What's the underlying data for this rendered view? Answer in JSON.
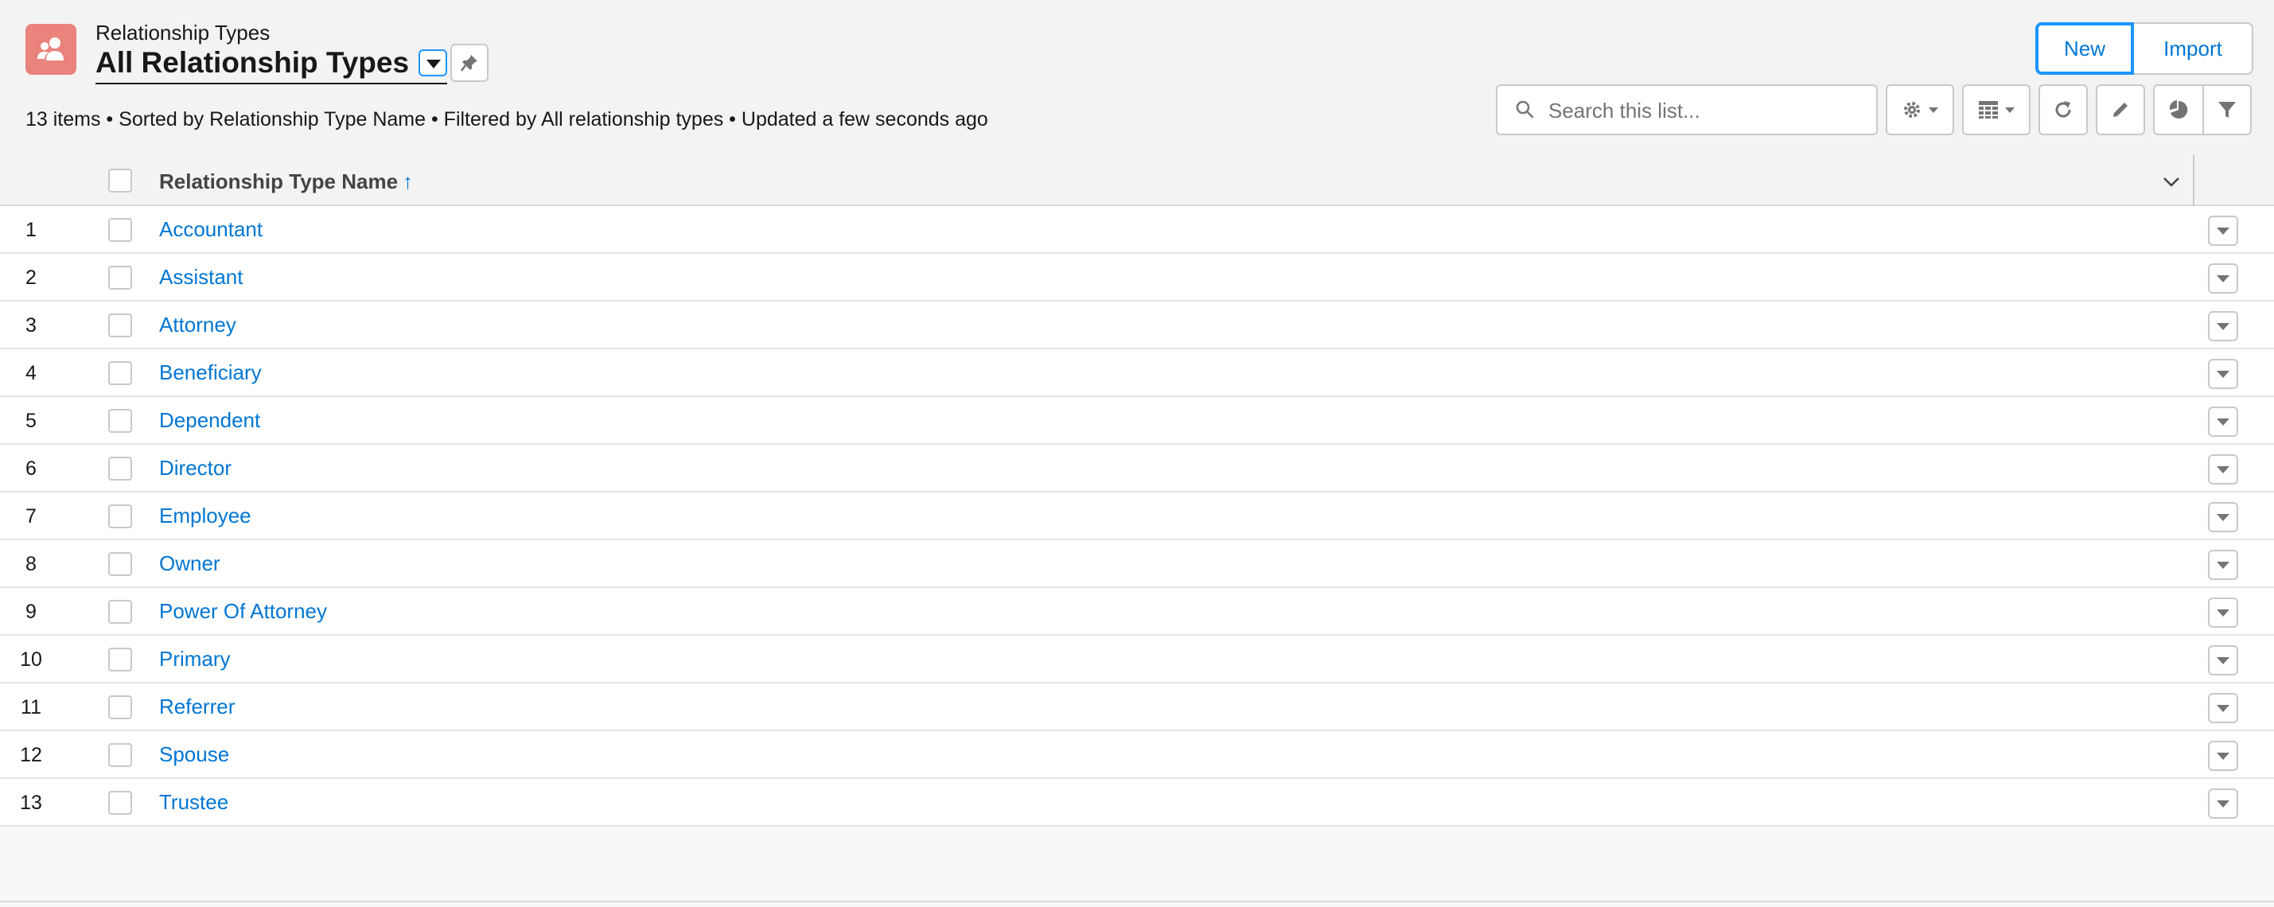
{
  "header": {
    "object_label": "Relationship Types",
    "list_title": "All Relationship Types",
    "summary": {
      "count": "13 items",
      "sort": "Sorted by Relationship Type Name",
      "filter": "Filtered by All relationship types",
      "updated": "Updated a few seconds ago",
      "separator": " • "
    },
    "buttons": {
      "new": "New",
      "import": "Import"
    },
    "search": {
      "placeholder": "Search this list...",
      "value": ""
    },
    "accent_color": "#0176d3",
    "icon_color": "#e9837c"
  },
  "table": {
    "column_header": "Relationship Type Name",
    "sort_indicator": "↑",
    "rows": [
      {
        "num": "1",
        "name": "Accountant"
      },
      {
        "num": "2",
        "name": "Assistant"
      },
      {
        "num": "3",
        "name": "Attorney"
      },
      {
        "num": "4",
        "name": "Beneficiary"
      },
      {
        "num": "5",
        "name": "Dependent"
      },
      {
        "num": "6",
        "name": "Director"
      },
      {
        "num": "7",
        "name": "Employee"
      },
      {
        "num": "8",
        "name": "Owner"
      },
      {
        "num": "9",
        "name": "Power Of Attorney"
      },
      {
        "num": "10",
        "name": "Primary"
      },
      {
        "num": "11",
        "name": "Referrer"
      },
      {
        "num": "12",
        "name": "Spouse"
      },
      {
        "num": "13",
        "name": "Trustee"
      }
    ]
  }
}
